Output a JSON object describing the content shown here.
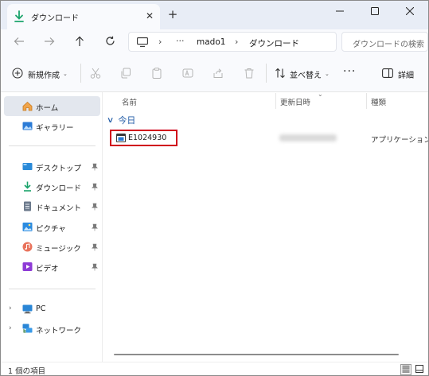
{
  "window": {
    "tab_title": "ダウンロード",
    "new_tab_label": "+",
    "tab_close": "✕"
  },
  "address": {
    "ellipsis": "···",
    "crumbs": [
      "mado1",
      "ダウンロード"
    ],
    "separator": "›",
    "search_placeholder": "ダウンロードの検索"
  },
  "toolbar": {
    "new_label": "新規作成",
    "sort_label": "並べ替え",
    "more_label": "···",
    "details_label": "詳細",
    "chevron": "⌄"
  },
  "sidebar": {
    "quick": [
      {
        "label": "ホーム",
        "icon": "home-icon",
        "selected": true
      },
      {
        "label": "ギャラリー",
        "icon": "gallery-icon",
        "selected": false
      }
    ],
    "pinned": [
      {
        "label": "デスクトップ",
        "icon": "desktop-icon"
      },
      {
        "label": "ダウンロード",
        "icon": "download-icon"
      },
      {
        "label": "ドキュメント",
        "icon": "documents-icon"
      },
      {
        "label": "ピクチャ",
        "icon": "pictures-icon"
      },
      {
        "label": "ミュージック",
        "icon": "music-icon"
      },
      {
        "label": "ビデオ",
        "icon": "videos-icon"
      }
    ],
    "tree": [
      {
        "label": "PC",
        "icon": "pc-icon",
        "expander": "›"
      },
      {
        "label": "ネットワーク",
        "icon": "network-icon",
        "expander": "›"
      }
    ]
  },
  "content": {
    "columns": [
      "名前",
      "更新日時",
      "種類"
    ],
    "group_label": "今日",
    "files": [
      {
        "name": "E1024930",
        "type": "アプリケーション"
      }
    ]
  },
  "status": {
    "item_count": "1 個の項目"
  },
  "colors": {
    "accent": "#1f5aa6",
    "highlight_border": "#d0021b",
    "selection_bg": "#e3e7ee"
  }
}
